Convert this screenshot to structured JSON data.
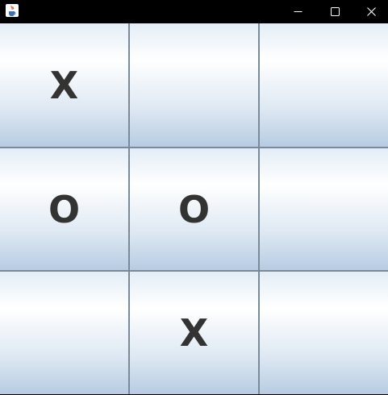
{
  "window": {
    "icon": "java-cup-icon",
    "controls": [
      "minimize-icon",
      "maximize-icon",
      "close-icon"
    ]
  },
  "board": {
    "cells": [
      {
        "mark": "X"
      },
      {
        "mark": ""
      },
      {
        "mark": ""
      },
      {
        "mark": "O"
      },
      {
        "mark": "O"
      },
      {
        "mark": ""
      },
      {
        "mark": ""
      },
      {
        "mark": "X"
      },
      {
        "mark": ""
      }
    ]
  },
  "colors": {
    "mark": "#333333",
    "grid": "#7a8a99",
    "cell_top": "#e3edf6",
    "cell_bottom": "#b7cce2"
  }
}
